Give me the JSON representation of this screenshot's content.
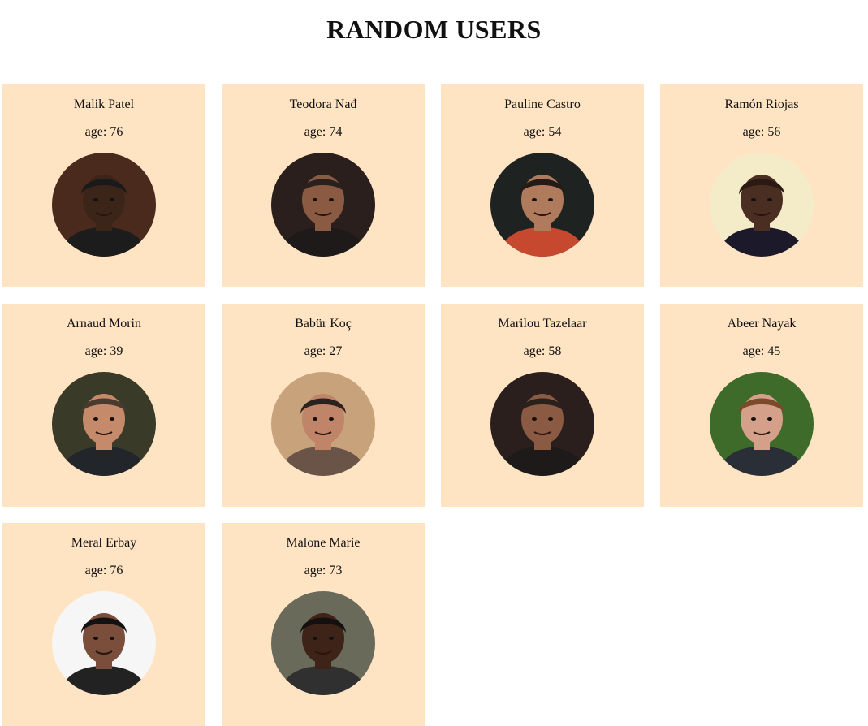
{
  "page": {
    "title": "RANDOM USERS"
  },
  "users": [
    {
      "name": "Malik Patel",
      "age_text": "age: 76",
      "avatar": "photo-man-dark-shirt",
      "bg": "#4a2a1c",
      "skin": "#3b2418",
      "hair": "#1a1a1a",
      "shirt": "#1c1c1c"
    },
    {
      "name": "Teodora Nađ",
      "age_text": "age: 74",
      "avatar": "photo-woman-curly-hair",
      "bg": "#2a1f1c",
      "skin": "#8a5a42",
      "hair": "#2a201c",
      "shirt": "#1e1a1a"
    },
    {
      "name": "Pauline Castro",
      "age_text": "age: 54",
      "avatar": "photo-woman-red-dress",
      "bg": "#1e2220",
      "skin": "#b07a5c",
      "hair": "#241a16",
      "shirt": "#c6482e"
    },
    {
      "name": "Ramón Riojas",
      "age_text": "age: 56",
      "avatar": "photo-man-selfie",
      "bg": "#f4ecc8",
      "skin": "#4a2e22",
      "hair": "#2a1a12",
      "shirt": "#1c1a2a"
    },
    {
      "name": "Arnaud Morin",
      "age_text": "age: 39",
      "avatar": "photo-man-cap-beard",
      "bg": "#3a3a28",
      "skin": "#c48a6a",
      "hair": "#4a3a30",
      "shirt": "#22262a"
    },
    {
      "name": "Babür Koç",
      "age_text": "age: 27",
      "avatar": "photo-man-waving",
      "bg": "#c8a27a",
      "skin": "#c08468",
      "hair": "#2a221e",
      "shirt": "#6a5448"
    },
    {
      "name": "Marilou Tazelaar",
      "age_text": "age: 58",
      "avatar": "photo-woman-curly-hair",
      "bg": "#2a1f1c",
      "skin": "#8a5a42",
      "hair": "#2a201c",
      "shirt": "#1e1a1a"
    },
    {
      "name": "Abeer Nayak",
      "age_text": "age: 45",
      "avatar": "photo-man-suit-beard",
      "bg": "#3e6a2a",
      "skin": "#d4a08a",
      "hair": "#7a4a2a",
      "shirt": "#2a2e36"
    },
    {
      "name": "Meral Erbay",
      "age_text": "age: 76",
      "avatar": "photo-woman-bob-hair",
      "bg": "#f6f6f6",
      "skin": "#7a4e3a",
      "hair": "#121212",
      "shirt": "#222"
    },
    {
      "name": "Malone Marie",
      "age_text": "age: 73",
      "avatar": "photo-man-short-hair",
      "bg": "#6a6a5a",
      "skin": "#3e2418",
      "hair": "#141010",
      "shirt": "#303030"
    }
  ]
}
